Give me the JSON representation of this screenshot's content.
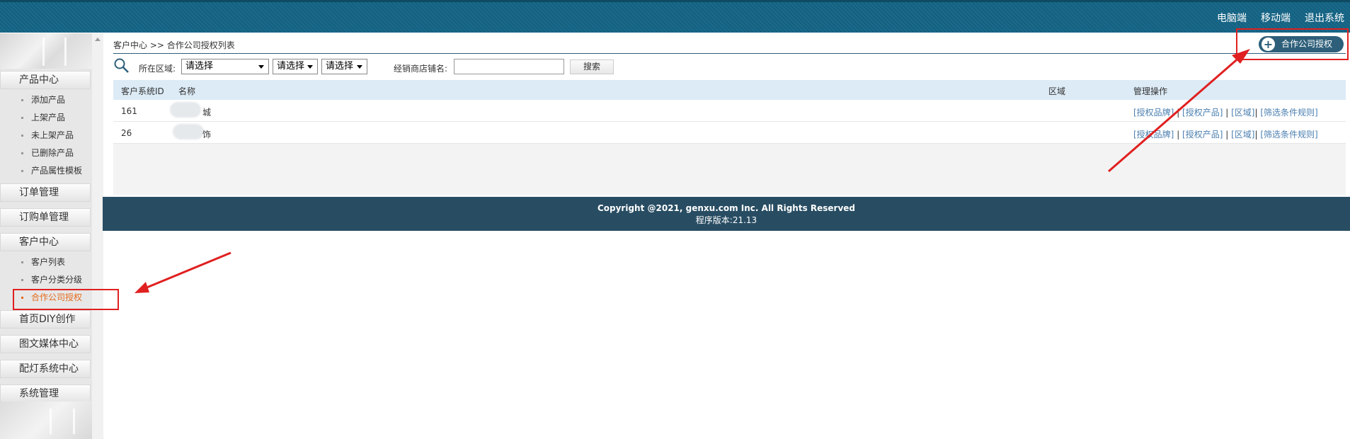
{
  "header": {
    "links": [
      "电脑端",
      "移动端",
      "退出系统"
    ]
  },
  "sidebar": {
    "groups": [
      {
        "label": "产品中心",
        "items": [
          "添加产品",
          "上架产品",
          "未上架产品",
          "已删除产品",
          "产品属性模板"
        ]
      },
      {
        "label": "订单管理",
        "items": []
      },
      {
        "label": "订购单管理",
        "items": []
      },
      {
        "label": "客户中心",
        "items": [
          "客户列表",
          "客户分类分级",
          "合作公司授权"
        ]
      },
      {
        "label": "首页DIY创作",
        "items": []
      },
      {
        "label": "图文媒体中心",
        "items": []
      },
      {
        "label": "配灯系统中心",
        "items": []
      },
      {
        "label": "系统管理",
        "items": []
      }
    ],
    "active_item": "合作公司授权"
  },
  "main": {
    "breadcrumb": "客户中心 >> 合作公司授权列表",
    "add_button": "合作公司授权",
    "filter": {
      "region_label": "所在区域:",
      "select1": "请选择",
      "select2": "请选择",
      "select3": "请选择",
      "shop_label": "经销商店铺名:",
      "shop_value": "",
      "search_button": "搜索"
    },
    "table": {
      "headers": [
        "客户系统ID",
        "名称",
        "区域",
        "管理操作"
      ],
      "rows": [
        {
          "id": "161",
          "name": "城",
          "region": ""
        },
        {
          "id": "26",
          "name": "饰",
          "region": ""
        }
      ],
      "actions": [
        "[授权品牌]",
        "[授权产品]",
        "[区域]",
        "[筛选条件规则]"
      ]
    }
  },
  "footer": {
    "copyright": "Copyright @2021, genxu.com Inc. All Rights Reserved",
    "version": "程序版本:21.13"
  },
  "colors": {
    "header": "#1a6a8b",
    "footer": "#284d63",
    "accent": "#2e5f7a",
    "active": "#e36b1f",
    "annotation": "#e02020"
  }
}
